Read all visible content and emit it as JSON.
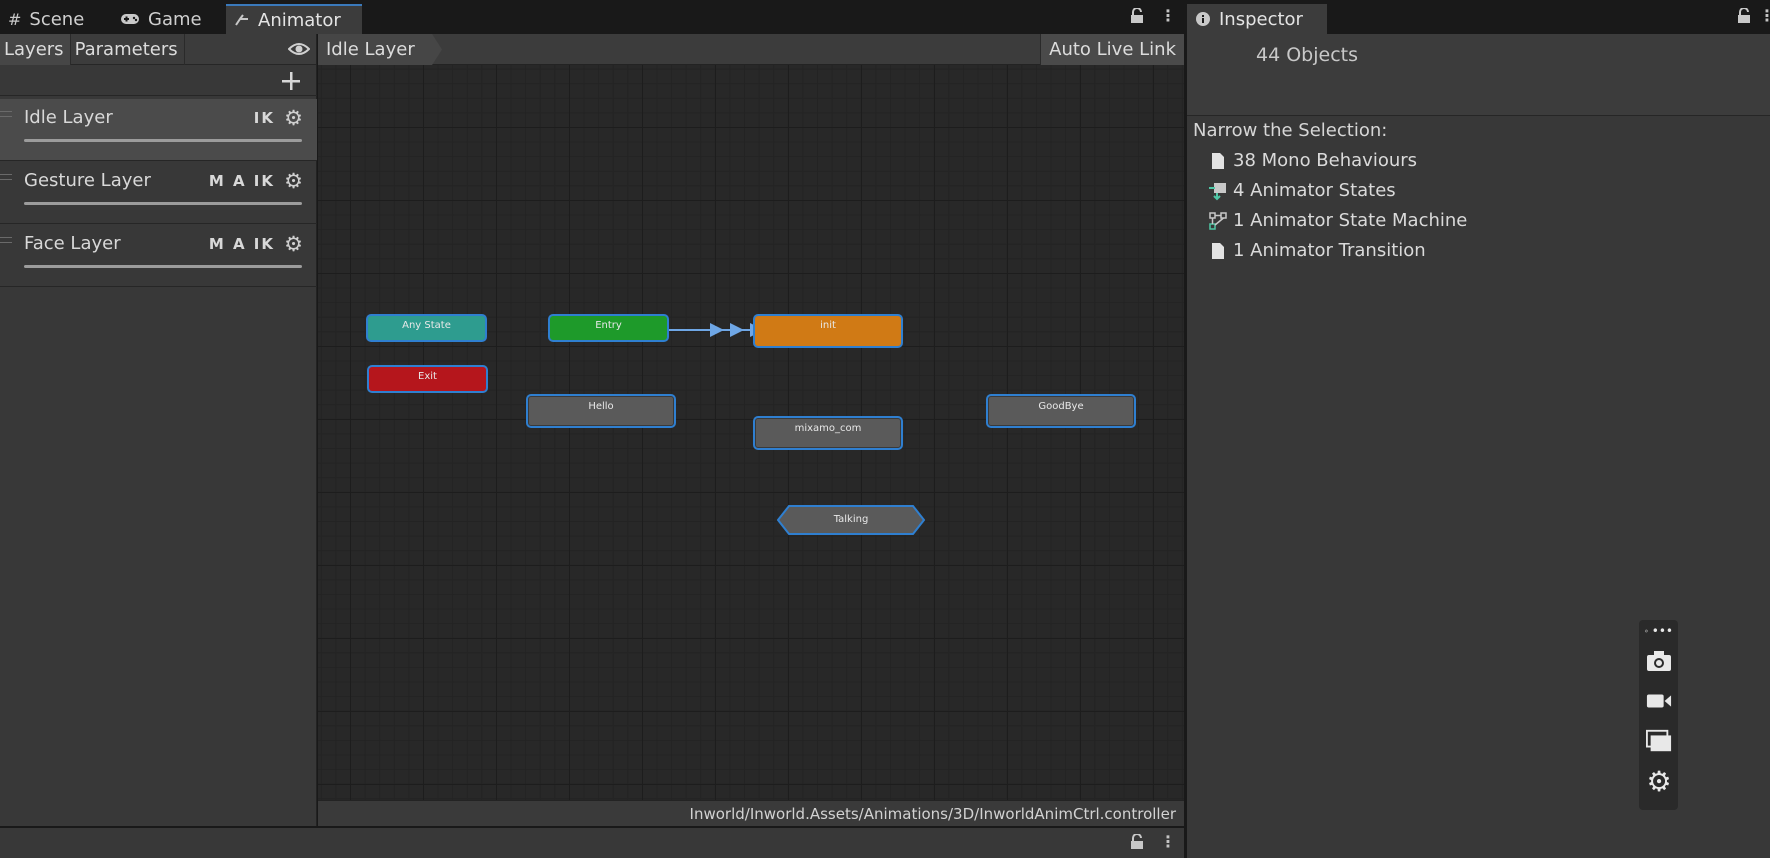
{
  "tabs": {
    "scene": "Scene",
    "game": "Game",
    "animator": "Animator",
    "inspector": "Inspector"
  },
  "left_panel": {
    "subtabs": [
      "Layers",
      "Parameters"
    ],
    "layers": [
      {
        "name": "Idle Layer",
        "flags": "IK",
        "selected": true
      },
      {
        "name": "Gesture Layer",
        "flags": "M A IK",
        "selected": false
      },
      {
        "name": "Face Layer",
        "flags": "M A IK",
        "selected": false
      }
    ]
  },
  "graph": {
    "breadcrumb": "Idle Layer",
    "auto_live_link": "Auto Live Link",
    "nodes": {
      "any_state": {
        "label": "Any State",
        "color": "#2e9c8f"
      },
      "entry": {
        "label": "Entry",
        "color": "#1e9a2a"
      },
      "init": {
        "label": "init",
        "color": "#d07a15"
      },
      "exit": {
        "label": "Exit",
        "color": "#b5161c"
      },
      "hello": {
        "label": "Hello"
      },
      "mixamo": {
        "label": "mixamo_com"
      },
      "goodbye": {
        "label": "GoodBye"
      },
      "talking": {
        "label": "Talking"
      }
    },
    "footer_path": "Inworld/Inworld.Assets/Animations/3D/InworldAnimCtrl.controller"
  },
  "inspector": {
    "count": "44 Objects",
    "narrow_label": "Narrow the Selection:",
    "items": [
      {
        "label": "38 Mono Behaviours",
        "icon": "document-icon"
      },
      {
        "label": "4 Animator States",
        "icon": "animator-state-icon"
      },
      {
        "label": "1 Animator State Machine",
        "icon": "state-machine-icon"
      },
      {
        "label": "1 Animator Transition",
        "icon": "document-icon"
      }
    ]
  },
  "colors": {
    "accent": "#2f7fd0",
    "panel": "#383838",
    "graph_bg": "#282828"
  }
}
